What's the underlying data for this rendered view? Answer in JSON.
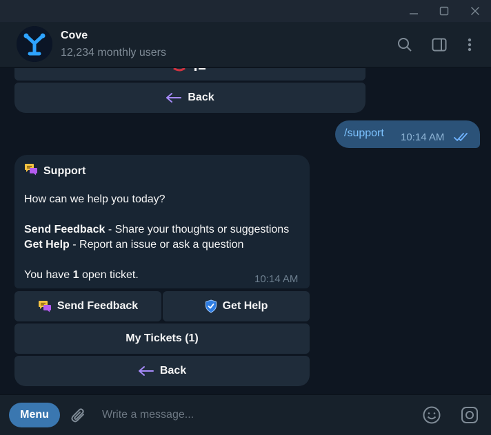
{
  "chat": {
    "title": "Cove",
    "subtitle": "12,234 monthly users"
  },
  "prev_keyboard": {
    "back_label": "Back"
  },
  "outgoing": {
    "text": "/support",
    "time": "10:14 AM"
  },
  "incoming": {
    "title": "Support",
    "intro": "How can we help you today?",
    "feedback_bold": "Send Feedback",
    "feedback_desc": " - Share your thoughts or suggestions",
    "help_bold": "Get Help",
    "help_desc": " - Report an issue or ask a question",
    "ticket_prefix": "You have ",
    "ticket_count": "1",
    "ticket_suffix": " open ticket.",
    "time": "10:14 AM"
  },
  "keyboard": {
    "send_feedback": "Send Feedback",
    "get_help": "Get Help",
    "my_tickets": "My Tickets (1)",
    "back": "Back"
  },
  "composer": {
    "menu_label": "Menu",
    "placeholder": "Write a message..."
  },
  "colors": {
    "background": "#0e1621",
    "header": "#17212b",
    "bubble_out": "#2b5278",
    "bubble_in": "#182533",
    "button": "#1f2c3a",
    "accent": "#3a77b0"
  }
}
